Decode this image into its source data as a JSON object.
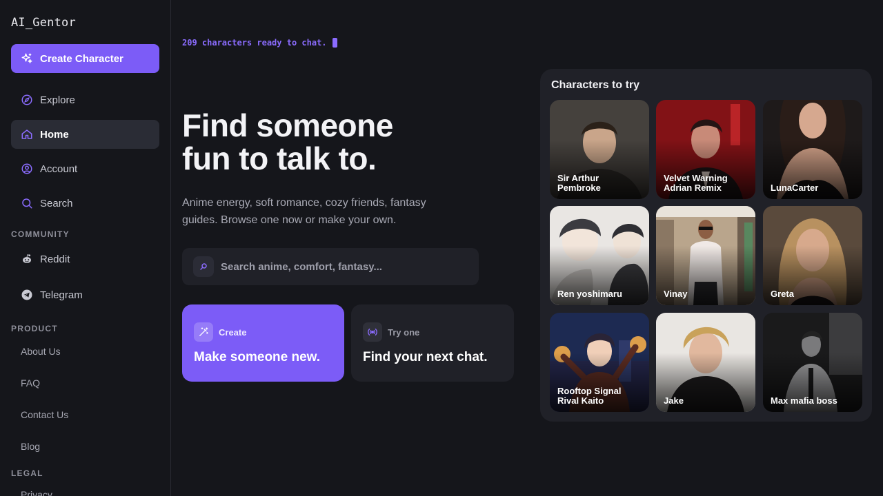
{
  "sidebar": {
    "logo": "AI_Gentor",
    "create_label": "Create Character",
    "nav": [
      {
        "label": "Explore",
        "icon": "compass-icon"
      },
      {
        "label": "Home",
        "icon": "home-icon",
        "active": true
      },
      {
        "label": "Account",
        "icon": "user-circle-icon"
      },
      {
        "label": "Search",
        "icon": "search-icon"
      }
    ],
    "community_label": "COMMUNITY",
    "community": [
      {
        "label": "Reddit",
        "icon": "reddit-icon"
      },
      {
        "label": "Telegram",
        "icon": "telegram-icon"
      }
    ],
    "product_label": "PRODUCT",
    "product": [
      "About Us",
      "FAQ",
      "Contact Us",
      "Blog"
    ],
    "legal_label": "LEGAL",
    "legal": [
      "Privacy"
    ]
  },
  "main": {
    "typing_text": "209 characters ready to chat.",
    "hero_line1": "Find someone",
    "hero_line2": "fun to talk to.",
    "subtitle": "Anime energy, soft romance, cozy friends, fantasy guides. Browse one now or make your own.",
    "search_placeholder": "Search anime, comfort, fantasy...",
    "cards": [
      {
        "kicker": "Create",
        "title": "Make someone new.",
        "icon": "magic-wand-icon"
      },
      {
        "kicker": "Try one",
        "title": "Find your next chat.",
        "icon": "broadcast-icon"
      }
    ]
  },
  "panel": {
    "title": "Characters to try",
    "characters": [
      {
        "name": "Sir Arthur Pembroke"
      },
      {
        "name": "Velvet Warning Adrian Remix"
      },
      {
        "name": "LunaCarter"
      },
      {
        "name": "Ren yoshimaru"
      },
      {
        "name": "Vinay"
      },
      {
        "name": "Greta"
      },
      {
        "name": "Rooftop Signal Rival Kaito"
      },
      {
        "name": "Jake"
      },
      {
        "name": "Max mafia boss"
      }
    ]
  },
  "colors": {
    "accent": "#7c5cf7",
    "background": "#15161b",
    "panel": "#202128"
  }
}
